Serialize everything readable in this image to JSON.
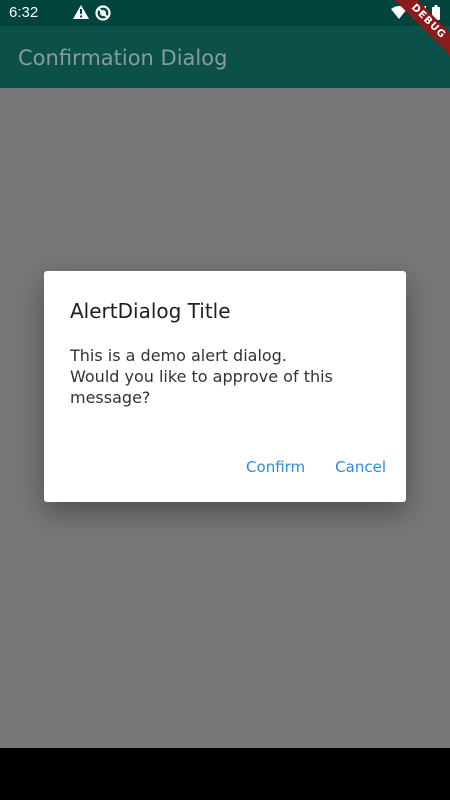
{
  "status_bar": {
    "time": "6:32",
    "left_icons": [
      "warning-icon",
      "blocked-icon"
    ],
    "right_icons": [
      "wifi-icon",
      "signal-icon",
      "battery-icon"
    ]
  },
  "app_bar": {
    "title": "Confirmation Dialog",
    "debug_banner": "DEBUG"
  },
  "dialog": {
    "title": "AlertDialog Title",
    "body": "            This is a demo alert dialog.\nWould you like to approve of this\nmessage?",
    "actions": [
      {
        "label": "Confirm"
      },
      {
        "label": "Cancel"
      }
    ]
  },
  "colors": {
    "status_bar": "#00443d",
    "app_bar": "#0b514a",
    "scrim": "#777777",
    "accent": "#2b8ae0"
  }
}
